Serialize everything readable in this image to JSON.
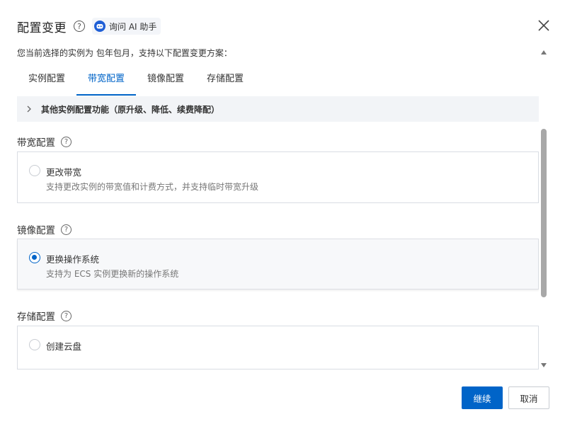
{
  "dialog": {
    "title": "配置变更",
    "help_symbol": "?",
    "ai_assistant_label": "询问 AI 助手",
    "subtitle": "您当前选择的实例为 包年包月，支持以下配置变更方案："
  },
  "tabs": [
    {
      "label": "实例配置",
      "active": false
    },
    {
      "label": "带宽配置",
      "active": true
    },
    {
      "label": "镜像配置",
      "active": false
    },
    {
      "label": "存储配置",
      "active": false
    }
  ],
  "collapse_bar": {
    "label": "其他实例配置功能（原升级、降低、续费降配）"
  },
  "sections": {
    "bandwidth": {
      "title": "带宽配置",
      "option_title": "更改带宽",
      "option_desc": "支持更改实例的带宽值和计费方式，并支持临时带宽升级",
      "selected": false
    },
    "image": {
      "title": "镜像配置",
      "option_title": "更换操作系统",
      "option_desc": "支持为 ECS 实例更换新的操作系统",
      "selected": true
    },
    "storage": {
      "title": "存储配置",
      "option_title": "创建云盘",
      "selected": false
    }
  },
  "footer": {
    "continue_label": "继续",
    "cancel_label": "取消"
  },
  "colors": {
    "accent": "#0064c8",
    "collapse_bg": "#f2f4f7",
    "border": "#d9dde3"
  }
}
